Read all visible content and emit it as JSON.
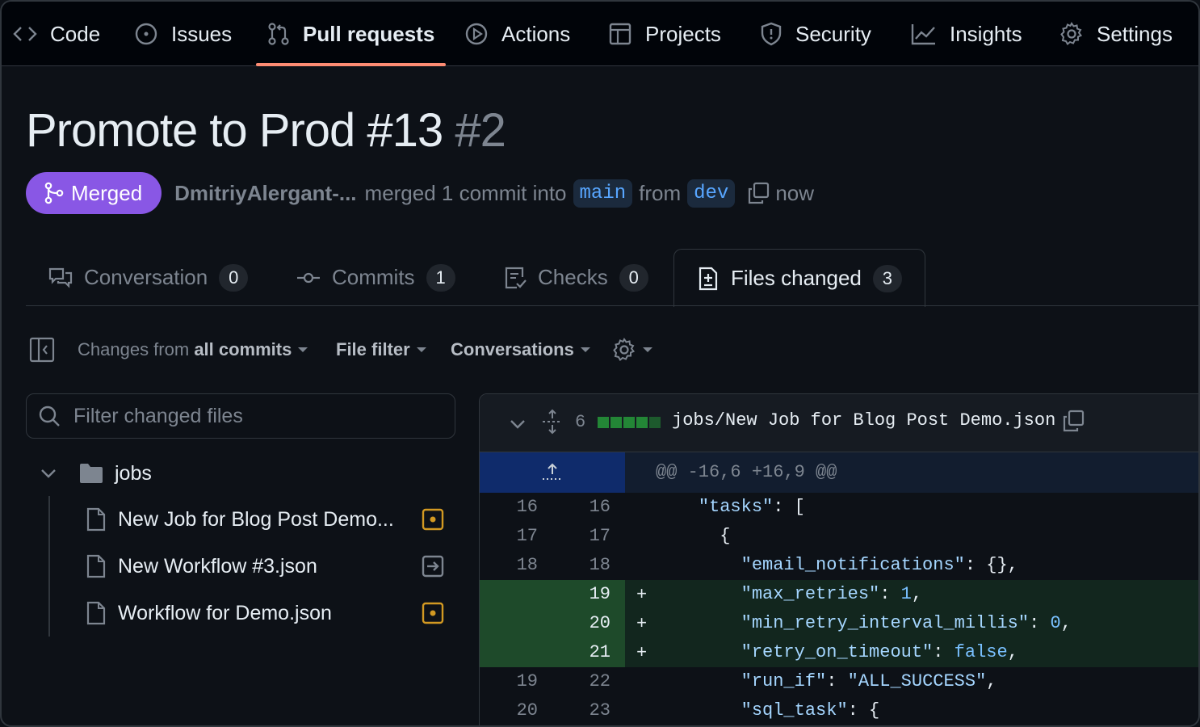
{
  "nav": {
    "items": [
      {
        "label": "Code",
        "icon": "code-icon"
      },
      {
        "label": "Issues",
        "icon": "issue-icon"
      },
      {
        "label": "Pull requests",
        "icon": "pull-request-icon",
        "active": true
      },
      {
        "label": "Actions",
        "icon": "play-icon"
      },
      {
        "label": "Projects",
        "icon": "table-icon"
      },
      {
        "label": "Security",
        "icon": "shield-icon"
      },
      {
        "label": "Insights",
        "icon": "graph-icon"
      },
      {
        "label": "Settings",
        "icon": "gear-icon"
      }
    ]
  },
  "pr": {
    "title": "Promote to Prod #13",
    "number": "#2",
    "status": "Merged",
    "author": "DmitriyAlergant-...",
    "merged_text": "merged 1 commit into",
    "base_branch": "main",
    "from_text": "from",
    "head_branch": "dev",
    "time": "now"
  },
  "tabs": [
    {
      "label": "Conversation",
      "count": "0",
      "icon": "comment-discussion-icon"
    },
    {
      "label": "Commits",
      "count": "1",
      "icon": "commit-icon"
    },
    {
      "label": "Checks",
      "count": "0",
      "icon": "checklist-icon"
    },
    {
      "label": "Files changed",
      "count": "3",
      "icon": "file-diff-icon",
      "active": true
    }
  ],
  "toolbar": {
    "changes_prefix": "Changes from",
    "changes_value": "all commits",
    "file_filter": "File filter",
    "conversations": "Conversations"
  },
  "file_tree": {
    "filter_placeholder": "Filter changed files",
    "folder": "jobs",
    "files": [
      {
        "name": "New Job for Blog Post Demo...",
        "status": "modified"
      },
      {
        "name": "New Workflow #3.json",
        "status": "renamed"
      },
      {
        "name": "Workflow for Demo.json",
        "status": "modified"
      }
    ]
  },
  "diff": {
    "changes_count": "6",
    "diffstat": {
      "added_blocks": 5,
      "neutral_blocks": 0
    },
    "path": "jobs/New Job for Blog Post Demo.json",
    "hunk_header": "@@ -16,6 +16,9 @@",
    "lines": [
      {
        "old": "16",
        "new": "16",
        "type": "context",
        "text": "    \"tasks\": ["
      },
      {
        "old": "17",
        "new": "17",
        "type": "context",
        "text": "      {"
      },
      {
        "old": "18",
        "new": "18",
        "type": "context",
        "text": "        \"email_notifications\": {},"
      },
      {
        "old": "",
        "new": "19",
        "type": "add",
        "text": "        \"max_retries\": 1,"
      },
      {
        "old": "",
        "new": "20",
        "type": "add",
        "text": "        \"min_retry_interval_millis\": 0,"
      },
      {
        "old": "",
        "new": "21",
        "type": "add",
        "text": "        \"retry_on_timeout\": false,"
      },
      {
        "old": "19",
        "new": "22",
        "type": "context",
        "text": "        \"run_if\": \"ALL_SUCCESS\","
      },
      {
        "old": "20",
        "new": "23",
        "type": "context",
        "text": "        \"sql_task\": {"
      }
    ]
  },
  "colors": {
    "merged": "#8957e5",
    "accent_underline": "#fd8c73",
    "added_bg": "#12261e",
    "hunk_bg": "#0f2b6b",
    "modified_icon": "#d29922",
    "link": "#58a6ff"
  }
}
